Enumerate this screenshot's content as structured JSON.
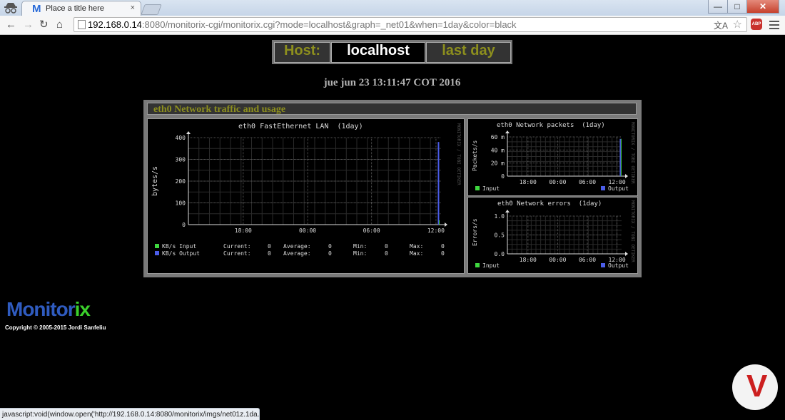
{
  "browser": {
    "tab_title": "Place a title here",
    "tab_close": "×",
    "favicon_m": "M",
    "url_host": "192.168.0.14",
    "url_rest": ":8080/monitorix-cgi/monitorix.cgi?mode=localhost&graph=_net01&when=1day&color=black",
    "abp_label": "ABP",
    "back": "←",
    "forward": "→",
    "reload": "↻",
    "home": "⌂",
    "translate": "文A",
    "star": "☆",
    "win_min": "—",
    "win_max": "□",
    "win_close": "✕"
  },
  "header": {
    "host_label": "Host:",
    "host_value": "localhost",
    "period": "last day",
    "datetime": "jue jun 23 13:11:47 COT 2016"
  },
  "panel": {
    "title": "eth0 Network traffic and usage"
  },
  "graphs": {
    "main": {
      "title": "eth0 FastEthernet LAN  (1day)",
      "ylabel": "bytes/s",
      "credit": "MONITORIX / TOBI OETIKER",
      "y_ticks": [
        "400",
        "300",
        "200",
        "100",
        "0"
      ],
      "x_ticks": [
        "18:00",
        "00:00",
        "06:00",
        "12:00"
      ],
      "legend": [
        {
          "label": "KB/s Input",
          "color": "#3fd83f",
          "current_label": "Current:",
          "current": "0",
          "average_label": "Average:",
          "average": "0",
          "min_label": "Min:",
          "min": "0",
          "max_label": "Max:",
          "max": "0"
        },
        {
          "label": "KB/s Output",
          "color": "#4b5de8",
          "current_label": "Current:",
          "current": "0",
          "average_label": "Average:",
          "average": "0",
          "min_label": "Min:",
          "min": "0",
          "max_label": "Max:",
          "max": "0"
        }
      ]
    },
    "packets": {
      "title": "eth0 Network packets  (1day)",
      "ylabel": "Packets/s",
      "credit": "MONITORIX / TOBI OETIKER",
      "y_ticks": [
        "60 m",
        "40 m",
        "20 m",
        "0"
      ],
      "x_ticks": [
        "18:00",
        "00:00",
        "06:00",
        "12:00"
      ],
      "legend_input": "Input",
      "legend_output": "Output"
    },
    "errors": {
      "title": "eth0 Network errors  (1day)",
      "ylabel": "Errors/s",
      "credit": "MONITORIX / TOBI OETIKER",
      "y_ticks": [
        "1.0",
        "0.5",
        "0.0"
      ],
      "x_ticks": [
        "18:00",
        "00:00",
        "06:00",
        "12:00"
      ],
      "legend_input": "Input",
      "legend_output": "Output"
    }
  },
  "footer": {
    "logo_part1": "Monitor",
    "logo_part2": "ix",
    "copyright": "Copyright © 2005-2015 Jordi Sanfeliu"
  },
  "statusbar": {
    "text": "javascript:void(window.open('http://192.168.0.14:8080/monitorix/imgs/net01z.1da..."
  },
  "colors": {
    "input": "#3fd83f",
    "output": "#4b5de8",
    "accent": "#8d8f1e"
  }
}
